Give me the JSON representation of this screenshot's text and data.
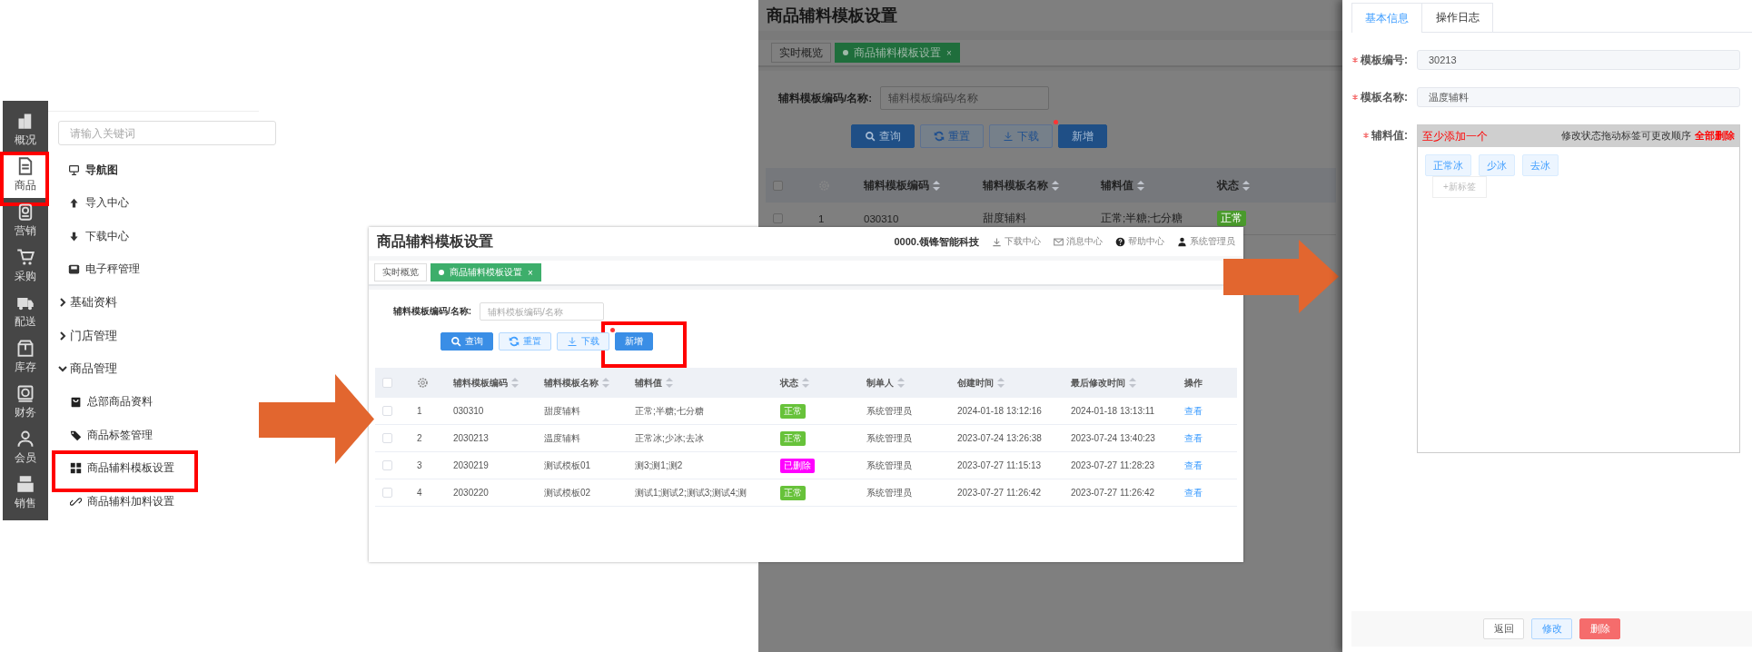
{
  "sidebar_screen": {
    "rail": [
      {
        "label": "概况",
        "selected": false,
        "highlighted": false
      },
      {
        "label": "商品",
        "selected": true,
        "highlighted": true
      },
      {
        "label": "营销",
        "selected": false,
        "highlighted": false
      },
      {
        "label": "采购",
        "selected": false,
        "highlighted": false
      },
      {
        "label": "配送",
        "selected": false,
        "highlighted": false
      },
      {
        "label": "库存",
        "selected": false,
        "highlighted": false
      },
      {
        "label": "财务",
        "selected": false,
        "highlighted": false
      },
      {
        "label": "会员",
        "selected": false,
        "highlighted": false
      },
      {
        "label": "销售",
        "selected": false,
        "highlighted": false
      }
    ],
    "search": {
      "placeholder": "请输入关键词"
    },
    "menu": [
      {
        "kind": "title",
        "label": "导航图"
      },
      {
        "kind": "link",
        "label": "导入中心"
      },
      {
        "kind": "link",
        "label": "下载中心"
      },
      {
        "kind": "link",
        "label": "电子秤管理"
      },
      {
        "kind": "group",
        "label": "基础资料",
        "expanded": false
      },
      {
        "kind": "group",
        "label": "门店管理",
        "expanded": false
      },
      {
        "kind": "group",
        "label": "商品管理",
        "expanded": true,
        "children": [
          {
            "label": "总部商品资料",
            "highlighted": false
          },
          {
            "label": "商品标签管理",
            "highlighted": false
          },
          {
            "label": "商品辅料模板设置",
            "highlighted": true
          },
          {
            "label": "商品辅料加料设置",
            "highlighted": false
          }
        ]
      }
    ]
  },
  "list_screen_back": {
    "title": "商品辅料模板设置",
    "tabs": [
      {
        "label": "实时概览",
        "selected": false
      },
      {
        "label": "商品辅料模板设置",
        "selected": true,
        "close": "×"
      }
    ],
    "filter": {
      "label": "辅料模板编码/名称:",
      "placeholder": "辅料模板编码/名称"
    },
    "buttons": [
      {
        "kind": "primary",
        "label": "查询",
        "dot": false,
        "highlighted": false
      },
      {
        "kind": "default",
        "label": "重置",
        "dot": false,
        "highlighted": false
      },
      {
        "kind": "default",
        "label": "下载",
        "dot": false,
        "highlighted": false
      },
      {
        "kind": "primary",
        "label": "新增",
        "dot": true,
        "highlighted": false
      }
    ],
    "table": {
      "select_all_checked": false,
      "columns": [
        {
          "label": "辅料模板编码",
          "sortable": true
        },
        {
          "label": "辅料模板名称",
          "sortable": true
        },
        {
          "label": "辅料值",
          "sortable": true
        },
        {
          "label": "状态",
          "sortable": true
        }
      ],
      "rows": [
        {
          "checked": false,
          "index": "1",
          "code": "030310",
          "name": "甜度辅料",
          "values": "正常;半糖;七分糖",
          "status": {
            "label": "正常",
            "color": "#4a9a2c"
          }
        }
      ]
    }
  },
  "list_screen": {
    "title": "商品辅料模板设置",
    "header": {
      "company": "0000.领锋智能科技",
      "links": [
        "下载中心",
        "消息中心",
        "帮助中心",
        "系统管理员"
      ]
    },
    "tabs": [
      {
        "label": "实时概览",
        "selected": false
      },
      {
        "label": "商品辅料模板设置",
        "selected": true,
        "close": "×"
      }
    ],
    "filter": {
      "label": "辅料模板编码/名称:",
      "placeholder": "辅料模板编码/名称"
    },
    "buttons": [
      {
        "kind": "primary",
        "label": "查询",
        "dot": false,
        "highlighted": false
      },
      {
        "kind": "default",
        "label": "重置",
        "dot": false,
        "highlighted": false
      },
      {
        "kind": "default",
        "label": "下载",
        "dot": false,
        "highlighted": false
      },
      {
        "kind": "primary",
        "label": "新增",
        "dot": true,
        "highlighted": true
      }
    ],
    "table": {
      "select_all_checked": false,
      "columns": [
        {
          "label": "辅料模板编码",
          "sortable": true
        },
        {
          "label": "辅料模板名称",
          "sortable": true
        },
        {
          "label": "辅料值",
          "sortable": true
        },
        {
          "label": "状态",
          "sortable": true
        },
        {
          "label": "制单人",
          "sortable": true
        },
        {
          "label": "创建时间",
          "sortable": true
        },
        {
          "label": "最后修改时间",
          "sortable": true
        },
        {
          "label": "操作",
          "sortable": false
        }
      ],
      "rows": [
        {
          "checked": false,
          "index": "1",
          "code": "030310",
          "name": "甜度辅料",
          "values": "正常;半糖;七分糖",
          "status": {
            "label": "正常",
            "color": "#67c23a"
          },
          "creator": "系统管理员",
          "created": "2024-01-18 13:12:16",
          "modified": "2024-01-18 13:13:11",
          "action": "查看"
        },
        {
          "checked": false,
          "index": "2",
          "code": "2030213",
          "name": "温度辅料",
          "values": "正常冰;少冰;去冰",
          "status": {
            "label": "正常",
            "color": "#67c23a"
          },
          "creator": "系统管理员",
          "created": "2023-07-24 13:26:38",
          "modified": "2023-07-24 13:40:23",
          "action": "查看"
        },
        {
          "checked": false,
          "index": "3",
          "code": "2030219",
          "name": "测试模板01",
          "values": "测3;测1;测2",
          "status": {
            "label": "已删除",
            "color": "#ff00ff"
          },
          "creator": "系统管理员",
          "created": "2023-07-27 11:15:13",
          "modified": "2023-07-27 11:28:23",
          "action": "查看"
        },
        {
          "checked": false,
          "index": "4",
          "code": "2030220",
          "name": "测试模板02",
          "values": "测试1;测试2;测试3;测试4;测",
          "status": {
            "label": "正常",
            "color": "#67c23a"
          },
          "creator": "系统管理员",
          "created": "2023-07-27 11:26:42",
          "modified": "2023-07-27 11:26:42",
          "action": "查看"
        }
      ]
    }
  },
  "detail_drawer": {
    "tabs": [
      {
        "label": "基本信息",
        "selected": true
      },
      {
        "label": "操作日志",
        "selected": false
      }
    ],
    "fields": [
      {
        "label": "模板编号:",
        "required": true,
        "value": "30213"
      },
      {
        "label": "模板名称:",
        "required": true,
        "value": "温度辅料"
      }
    ],
    "tag_editor": {
      "label": "辅料值:",
      "required": true,
      "warning": "至少添加一个",
      "hint": "修改状态拖动标签可更改顺序",
      "clear_all": "全部删除",
      "tags": [
        "正常冰",
        "少冰",
        "去冰"
      ],
      "add_tag": "+新标签"
    },
    "footer_buttons": [
      {
        "kind": "default",
        "label": "返回"
      },
      {
        "kind": "plain",
        "label": "修改"
      },
      {
        "kind": "danger",
        "label": "删除"
      }
    ]
  }
}
